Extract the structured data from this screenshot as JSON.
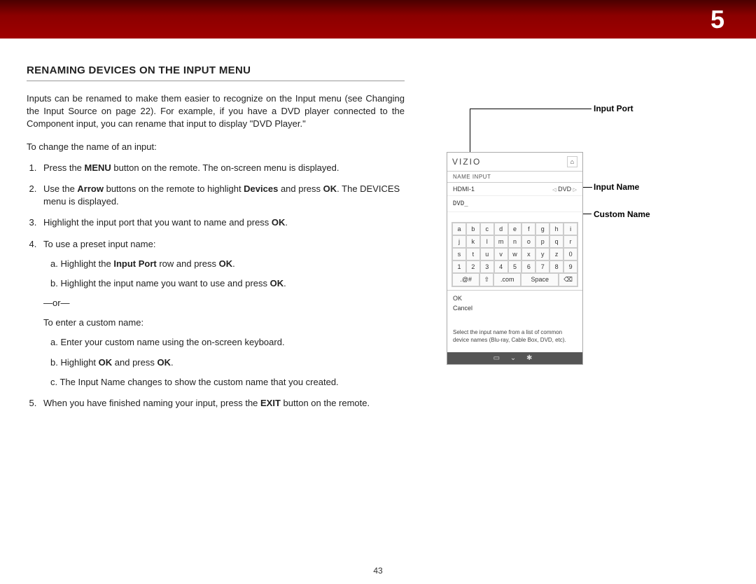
{
  "header": {
    "chapter": "5"
  },
  "title": "RENAMING DEVICES ON THE INPUT MENU",
  "intro": "Inputs can be renamed to make them easier to recognize on the Input menu (see Changing the Input Source on page 22). For example, if you have a DVD player connected to the Component input, you can rename that input to display \"DVD Player.\"",
  "lead": "To change the name of an input:",
  "steps": {
    "s1a": "Press the ",
    "s1b": "MENU",
    "s1c": " button on the remote. The on-screen menu is displayed.",
    "s2a": "Use the ",
    "s2b": "Arrow",
    "s2c": " buttons on the remote to highlight ",
    "s2d": "Devices",
    "s2e": " and press ",
    "s2f": "OK",
    "s2g": ". The DEVICES menu is displayed.",
    "s3a": "Highlight the input port that you want to name and press ",
    "s3b": "OK",
    "s3c": ".",
    "s4": "To use a preset input name:",
    "s4a1": "a.  Highlight the ",
    "s4a2": "Input Port",
    "s4a3": " row and press ",
    "s4a4": "OK",
    "s4a5": ".",
    "s4b1": "b.  Highlight the input name you want to use and press ",
    "s4b2": "OK",
    "s4b3": ".",
    "or": "—or—",
    "s4alt": "To enter a custom name:",
    "s4c": "a.  Enter your custom name using the on-screen keyboard.",
    "s4d1": "b.  Highlight ",
    "s4d2": "OK",
    "s4d3": " and press ",
    "s4d4": "OK",
    "s4d5": ".",
    "s4e": "c.  The Input Name changes to show the custom name that you created.",
    "s5a": "When you have finished naming your input, press the ",
    "s5b": "EXIT",
    "s5c": " button on the remote."
  },
  "callouts": {
    "port": "Input Port",
    "name": "Input Name",
    "custom": "Custom Name"
  },
  "device": {
    "brand": "VIZIO",
    "section": "NAME INPUT",
    "port_label": "HDMI-1",
    "current_name": "DVD",
    "custom_field": "DVD_",
    "kb_rows": [
      [
        "a",
        "b",
        "c",
        "d",
        "e",
        "f",
        "g",
        "h",
        "i"
      ],
      [
        "j",
        "k",
        "l",
        "m",
        "n",
        "o",
        "p",
        "q",
        "r"
      ],
      [
        "s",
        "t",
        "u",
        "v",
        "w",
        "x",
        "y",
        "z",
        "0"
      ],
      [
        "1",
        "2",
        "3",
        "4",
        "5",
        "6",
        "7",
        "8",
        "9"
      ]
    ],
    "kb_sym": ".@#",
    "kb_shift": "⇧",
    "kb_com": ".com",
    "kb_space": "Space",
    "kb_del": "⌫",
    "ok": "OK",
    "cancel": "Cancel",
    "help": "Select the input name from a list of common device names (Blu-ray, Cable Box, DVD, etc).",
    "footer_icons": "▭ ⌄ ✱"
  },
  "page_number": "43"
}
